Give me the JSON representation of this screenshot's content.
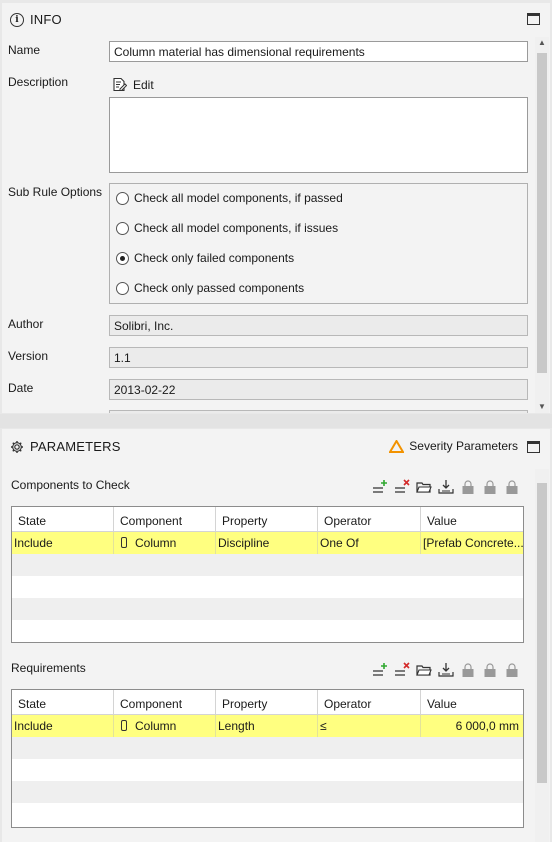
{
  "info": {
    "title": "INFO",
    "fields": {
      "name_label": "Name",
      "name_value": "Column material has dimensional requirements",
      "description_label": "Description",
      "edit_label": "Edit",
      "sub_rule_label": "Sub Rule Options",
      "author_label": "Author",
      "author_value": "Solibri, Inc.",
      "version_label": "Version",
      "version_value": "1.1",
      "date_label": "Date",
      "date_value": "2013-02-22"
    },
    "sub_rule_options": [
      {
        "label": "Check all model components, if passed",
        "checked": false
      },
      {
        "label": "Check all model components, if issues",
        "checked": false
      },
      {
        "label": "Check only failed components",
        "checked": true
      },
      {
        "label": "Check only passed components",
        "checked": false
      }
    ]
  },
  "parameters": {
    "title": "PARAMETERS",
    "severity_label": "Severity Parameters",
    "components_to_check": {
      "title": "Components to Check",
      "columns": [
        "State",
        "Component",
        "Property",
        "Operator",
        "Value"
      ],
      "rows": [
        {
          "state": "Include",
          "component": "Column",
          "property": "Discipline",
          "operator": "One Of",
          "value": "[Prefab Concrete..."
        }
      ]
    },
    "requirements": {
      "title": "Requirements",
      "columns": [
        "State",
        "Component",
        "Property",
        "Operator",
        "Value"
      ],
      "rows": [
        {
          "state": "Include",
          "component": "Column",
          "property": "Length",
          "operator": "≤",
          "value": "6 000,0 mm"
        }
      ]
    }
  },
  "colors": {
    "selected_row": "#ffff80",
    "severity_icon": "#f29200",
    "add_icon": "#2fa82f",
    "remove_icon": "#d42a2a"
  }
}
